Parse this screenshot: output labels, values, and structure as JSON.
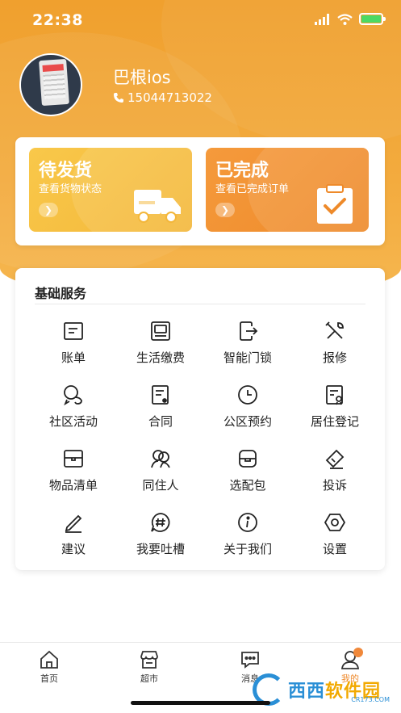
{
  "status_bar": {
    "time": "22:38"
  },
  "profile": {
    "name": "巴根ios",
    "phone": "15044713022"
  },
  "orders": {
    "pending": {
      "title": "待发货",
      "subtitle": "查看货物状态"
    },
    "completed": {
      "title": "已完成",
      "subtitle": "查看已完成订单"
    }
  },
  "services": {
    "title": "基础服务",
    "items": [
      {
        "label": "账单",
        "icon": "bill-icon"
      },
      {
        "label": "生活缴费",
        "icon": "monitor-icon"
      },
      {
        "label": "智能门锁",
        "icon": "door-lock-icon"
      },
      {
        "label": "报修",
        "icon": "tools-icon"
      },
      {
        "label": "社区活动",
        "icon": "chat-bubbles-icon"
      },
      {
        "label": "合同",
        "icon": "contract-icon"
      },
      {
        "label": "公区预约",
        "icon": "clock-icon"
      },
      {
        "label": "居住登记",
        "icon": "id-card-icon"
      },
      {
        "label": "物品清单",
        "icon": "box-icon"
      },
      {
        "label": "同住人",
        "icon": "people-icon"
      },
      {
        "label": "选配包",
        "icon": "package-icon"
      },
      {
        "label": "投诉",
        "icon": "tag-icon"
      },
      {
        "label": "建议",
        "icon": "pencil-icon"
      },
      {
        "label": "我要吐槽",
        "icon": "hashtag-bubble-icon"
      },
      {
        "label": "关于我们",
        "icon": "info-icon"
      },
      {
        "label": "设置",
        "icon": "settings-icon"
      }
    ]
  },
  "tabbar": {
    "items": [
      {
        "label": "首页",
        "icon": "home-icon"
      },
      {
        "label": "超市",
        "icon": "store-icon"
      },
      {
        "label": "消息",
        "icon": "message-icon"
      },
      {
        "label": "我的",
        "icon": "user-icon"
      }
    ]
  },
  "watermark": {
    "brand_a": "西西",
    "brand_b": "软件园",
    "url": "CR173.COM"
  },
  "colors": {
    "accent": "#f0a02e",
    "active_tab": "#ef8a2c",
    "pending_tile": "#f9c84a",
    "done_tile": "#ee8a2a"
  }
}
